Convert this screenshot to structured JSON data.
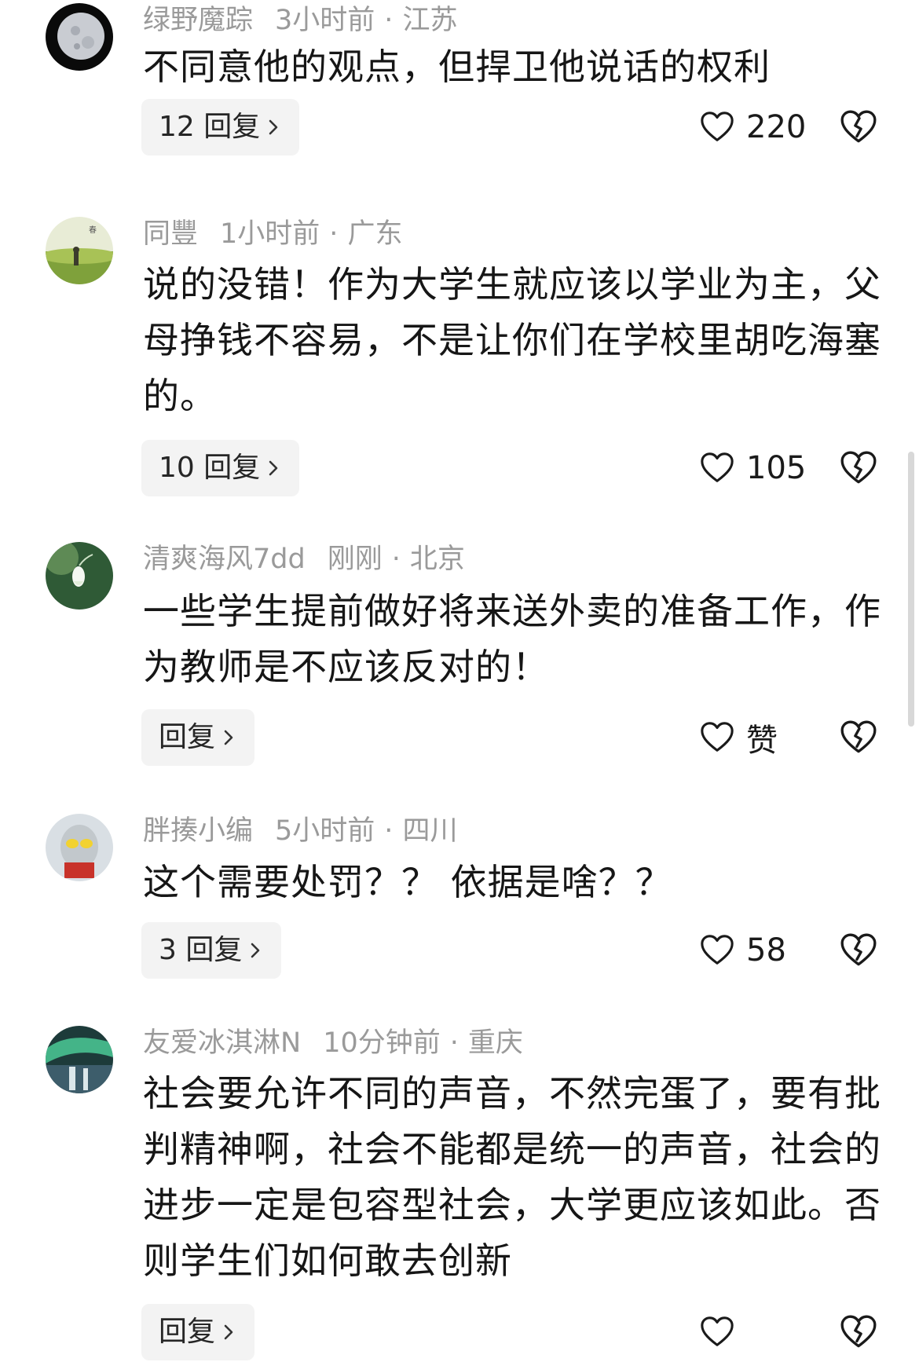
{
  "colors": {
    "meta": "#9a9a9a",
    "text": "#161616",
    "reply_bg": "#f3f3f3"
  },
  "comments": [
    {
      "username": "绿野魔踪",
      "time": "3小时前",
      "location": "江苏",
      "text": "不同意他的观点，但捍卫他说话的权利",
      "reply_label": "12 回复",
      "likes": "220",
      "avatar": "moon-avatar"
    },
    {
      "username": "同豐",
      "time": "1小时前",
      "location": "广东",
      "text": "说的没错！作为大学生就应该以学业为主，父母挣钱不容易，不是让你们在学校里胡吃海塞的。",
      "reply_label": "10 回复",
      "likes": "105",
      "avatar": "landscape-avatar"
    },
    {
      "username": "清爽海风7dd",
      "time": "刚刚",
      "location": "北京",
      "text": "一些学生提前做好将来送外卖的准备工作，作为教师是不应该反对的！",
      "reply_label": "回复",
      "likes": "赞",
      "avatar": "flower-avatar"
    },
    {
      "username": "胖揍小编",
      "time": "5小时前",
      "location": "四川",
      "text": "这个需要处罚？？ 依据是啥？？",
      "reply_label": "3 回复",
      "likes": "58",
      "avatar": "ultraman-avatar"
    },
    {
      "username": "友爱冰淇淋N",
      "time": "10分钟前",
      "location": "重庆",
      "text": "社会要允许不同的声音，不然完蛋了，要有批判精神啊，社会不能都是统一的声音，社会的进步一定是包容型社会，大学更应该如此。否则学生们如何敢去创新",
      "reply_label": "回复",
      "likes": "",
      "avatar": "aurora-avatar"
    }
  ]
}
